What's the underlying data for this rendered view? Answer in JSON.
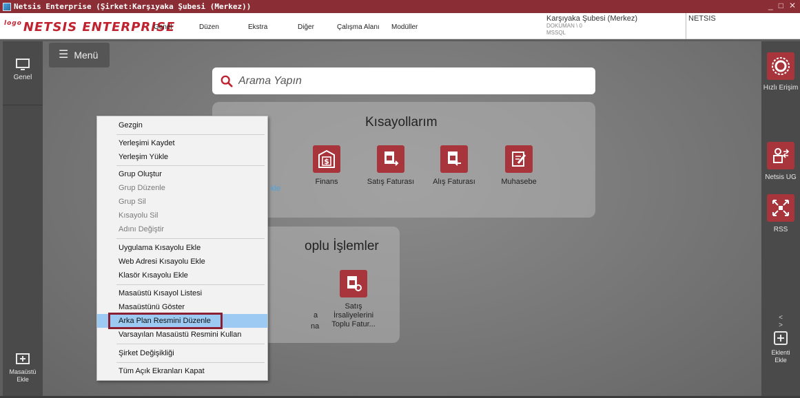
{
  "window": {
    "title": "Netsis Enterprise (Şirket:Karşıyaka Şubesi (Merkez))",
    "controls": [
      "_",
      "□",
      "✕"
    ]
  },
  "header": {
    "logo_prefix": "logo",
    "logo_text": "NETSIS ENTERPRISE",
    "menu": [
      "Genel",
      "Düzen",
      "Ekstra",
      "Diğer",
      "Çalışma Alanı",
      "Modüller"
    ],
    "company": "Karşıyaka Şubesi (Merkez)",
    "document": "DOKUMAN \\ 0",
    "db": "MSSQL",
    "user": "NETSIS"
  },
  "left_panel": {
    "genel_label": "Genel",
    "add_desktop_label": "Masaüstü\nEkle"
  },
  "desktop": {
    "menu_button": "Menü",
    "search_placeholder": "Arama Yapın",
    "kisayollar_title": "Kısayollarım",
    "kisayollar": [
      {
        "label": "Finans",
        "icon": "dollar-icon"
      },
      {
        "label": "Satış Faturası",
        "icon": "invoice-out-icon"
      },
      {
        "label": "Alış Faturası",
        "icon": "invoice-in-icon"
      },
      {
        "label": "Muhasebe",
        "icon": "accounting-icon"
      }
    ],
    "kisayollar_partial": "kle",
    "toplu_title": "oplu İşlemler",
    "toplu_partial": [
      "a",
      "na"
    ],
    "toplu_items": [
      {
        "label": "Satış İrsaliyelerini Toplu Fatur...",
        "line1": "Satış",
        "line2": "İrsaliyelerini",
        "line3": "Toplu Fatur...",
        "icon": "bulk-invoice-icon"
      }
    ]
  },
  "context_menu": {
    "items": [
      {
        "label": "Gezgin",
        "disabled": false
      },
      {
        "label": "Yerleşimi Kaydet",
        "disabled": false
      },
      {
        "label": "Yerleşim Yükle",
        "disabled": false
      },
      {
        "label": "Grup Oluştur",
        "disabled": false
      },
      {
        "label": "Grup Düzenle",
        "disabled": true
      },
      {
        "label": "Grup Sil",
        "disabled": true
      },
      {
        "label": "Kısayolu Sil",
        "disabled": true
      },
      {
        "label": "Adını Değiştir",
        "disabled": true
      },
      {
        "label": "Uygulama Kısayolu Ekle",
        "disabled": false
      },
      {
        "label": "Web Adresi Kısayolu Ekle",
        "disabled": false
      },
      {
        "label": "Klasör Kısayolu Ekle",
        "disabled": false
      },
      {
        "label": "Masaüstü Kısayol Listesi",
        "disabled": false
      },
      {
        "label": "Masaüstünü Göster",
        "disabled": false
      },
      {
        "label": "Arka Plan Resmini Düzenle",
        "disabled": false,
        "selected": true
      },
      {
        "label": "Varsayılan Masaüstü Resmini Kullan",
        "disabled": false
      },
      {
        "label": "Şirket Değişikliği",
        "disabled": false
      },
      {
        "label": "Tüm Açık Ekranları Kapat",
        "disabled": false
      }
    ]
  },
  "right_panel": {
    "hizli_erisim": "Hızlı Erişim",
    "netsis_ug": "Netsis UG",
    "rss": "RSS",
    "nav": "< >",
    "eklenti": "Eklenti\nEkle"
  },
  "colors": {
    "brand": "#8b2d35",
    "tile": "#a8353c",
    "highlight": "#9ccaf2"
  }
}
